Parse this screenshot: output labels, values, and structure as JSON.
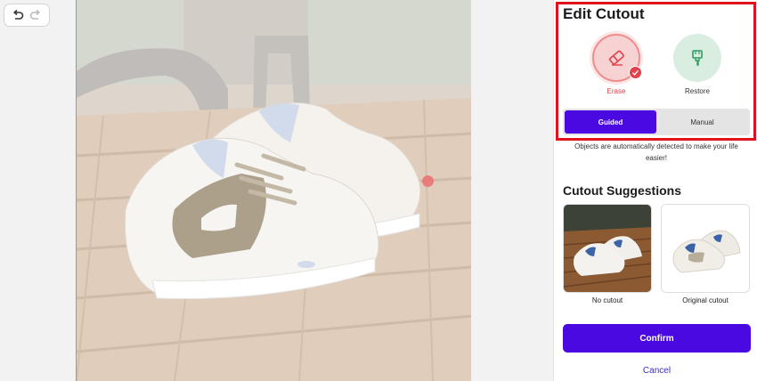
{
  "toolbar": {
    "undo_icon": "undo-icon",
    "redo_icon": "redo-icon"
  },
  "panel": {
    "title": "Edit Cutout",
    "tools": [
      {
        "label": "Erase",
        "icon": "eraser-icon",
        "selected": true
      },
      {
        "label": "Restore",
        "icon": "brush-icon",
        "selected": false
      }
    ],
    "modes": [
      {
        "label": "Guided",
        "active": true
      },
      {
        "label": "Manual",
        "active": false
      }
    ],
    "hint": "Objects are automatically detected to make your life easier!",
    "suggestions_title": "Cutout Suggestions",
    "suggestions": [
      {
        "label": "No cutout"
      },
      {
        "label": "Original cutout"
      }
    ],
    "confirm_label": "Confirm",
    "cancel_label": "Cancel"
  },
  "colors": {
    "accent": "#4b09e2",
    "erase": "#e2404a",
    "highlight": "#e0121e"
  }
}
